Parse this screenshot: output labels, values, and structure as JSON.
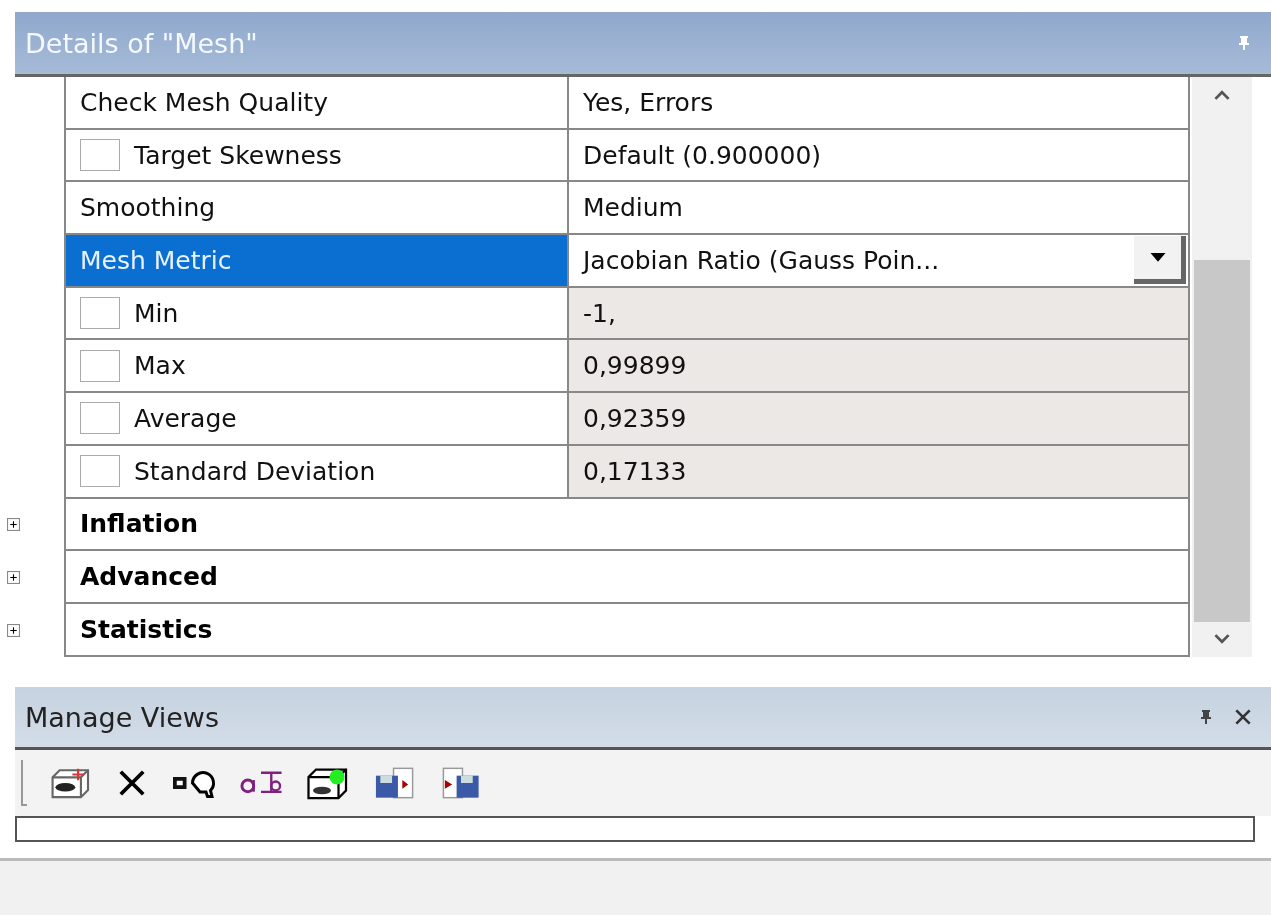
{
  "details_panel": {
    "title": "Details of \"Mesh\"",
    "rows": [
      {
        "kind": "property",
        "label": "Check Mesh Quality",
        "value": "Yes, Errors",
        "selected": false,
        "readonly": false
      },
      {
        "kind": "property",
        "label": "Target Skewness",
        "value": "Default (0.900000)",
        "checked": false,
        "selected": false,
        "readonly": false
      },
      {
        "kind": "property",
        "label": "Smoothing",
        "value": "Medium",
        "selected": false,
        "readonly": false
      },
      {
        "kind": "dropdown",
        "label": "Mesh Metric",
        "value": "Jacobian Ratio (Gauss Poin...",
        "selected": true,
        "readonly": false
      },
      {
        "kind": "property",
        "label": "Min",
        "value": "-1,",
        "checked": false,
        "selected": false,
        "readonly": true
      },
      {
        "kind": "property",
        "label": "Max",
        "value": "0,99899",
        "checked": false,
        "selected": false,
        "readonly": true
      },
      {
        "kind": "property",
        "label": "Average",
        "value": "0,92359",
        "checked": false,
        "selected": false,
        "readonly": true
      },
      {
        "kind": "property",
        "label": "Standard Deviation",
        "value": "0,17133",
        "checked": false,
        "selected": false,
        "readonly": true
      },
      {
        "kind": "group",
        "label": "Inflation",
        "expanded": false,
        "selected": false
      },
      {
        "kind": "group",
        "label": "Advanced",
        "expanded": false,
        "selected": false
      },
      {
        "kind": "group",
        "label": "Statistics",
        "expanded": false,
        "selected": false
      }
    ]
  },
  "manage_views": {
    "title": "Manage Views",
    "tools": [
      {
        "kind": "camera-box"
      },
      {
        "kind": "delete"
      },
      {
        "kind": "link-view"
      },
      {
        "kind": "rename"
      },
      {
        "kind": "camera-box-green"
      },
      {
        "kind": "save-export"
      },
      {
        "kind": "import"
      }
    ]
  }
}
